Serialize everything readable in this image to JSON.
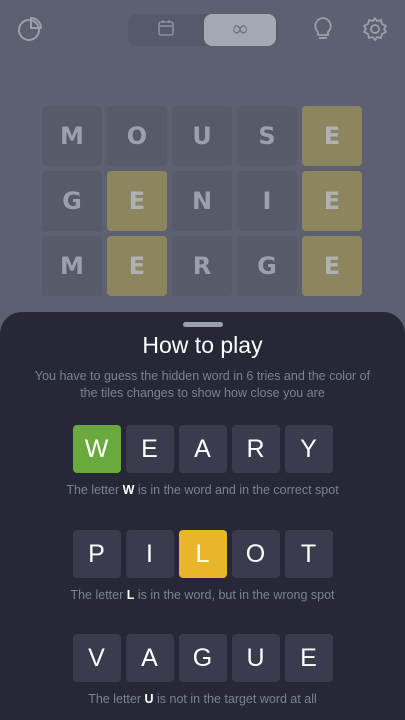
{
  "toolbar": {
    "stats_icon": "pie-chart-icon",
    "daily_icon": "calendar-icon",
    "unlimited_icon": "infinity-icon",
    "hint_icon": "lightbulb-icon",
    "settings_icon": "gear-icon",
    "unlimited_glyph": "∞"
  },
  "board": {
    "rows": [
      {
        "letters": [
          "M",
          "O",
          "U",
          "S",
          "E"
        ],
        "states": [
          "absent",
          "absent",
          "absent",
          "absent",
          "present"
        ]
      },
      {
        "letters": [
          "G",
          "E",
          "N",
          "I",
          "E"
        ],
        "states": [
          "absent",
          "present",
          "absent",
          "absent",
          "present"
        ]
      },
      {
        "letters": [
          "M",
          "E",
          "R",
          "G",
          "E"
        ],
        "states": [
          "absent",
          "present",
          "absent",
          "absent",
          "present"
        ]
      }
    ]
  },
  "sheet": {
    "title": "How to play",
    "description": "You have to guess the hidden word in 6 tries and the color of the tiles changes to show how close you are",
    "examples": [
      {
        "letters": [
          "W",
          "E",
          "A",
          "R",
          "Y"
        ],
        "states": [
          "correct",
          "empty",
          "empty",
          "empty",
          "empty"
        ],
        "caption_prefix": "The letter ",
        "caption_letter": "W",
        "caption_suffix": " is in the word and in the correct spot"
      },
      {
        "letters": [
          "P",
          "I",
          "L",
          "O",
          "T"
        ],
        "states": [
          "empty",
          "empty",
          "present",
          "empty",
          "empty"
        ],
        "caption_prefix": "The letter ",
        "caption_letter": "L",
        "caption_suffix": " is in the word, but in the wrong spot"
      },
      {
        "letters": [
          "V",
          "A",
          "G",
          "U",
          "E"
        ],
        "states": [
          "empty",
          "empty",
          "empty",
          "empty",
          "empty"
        ],
        "caption_prefix": "The letter ",
        "caption_letter": "U",
        "caption_suffix": " is not in the target word at all"
      }
    ]
  },
  "colors": {
    "correct": "#6aaa3c",
    "present": "#e9b52a",
    "tile_empty": "#3a3c4d",
    "sheet_bg": "#262837",
    "overlay_bg": "#5c6070"
  }
}
